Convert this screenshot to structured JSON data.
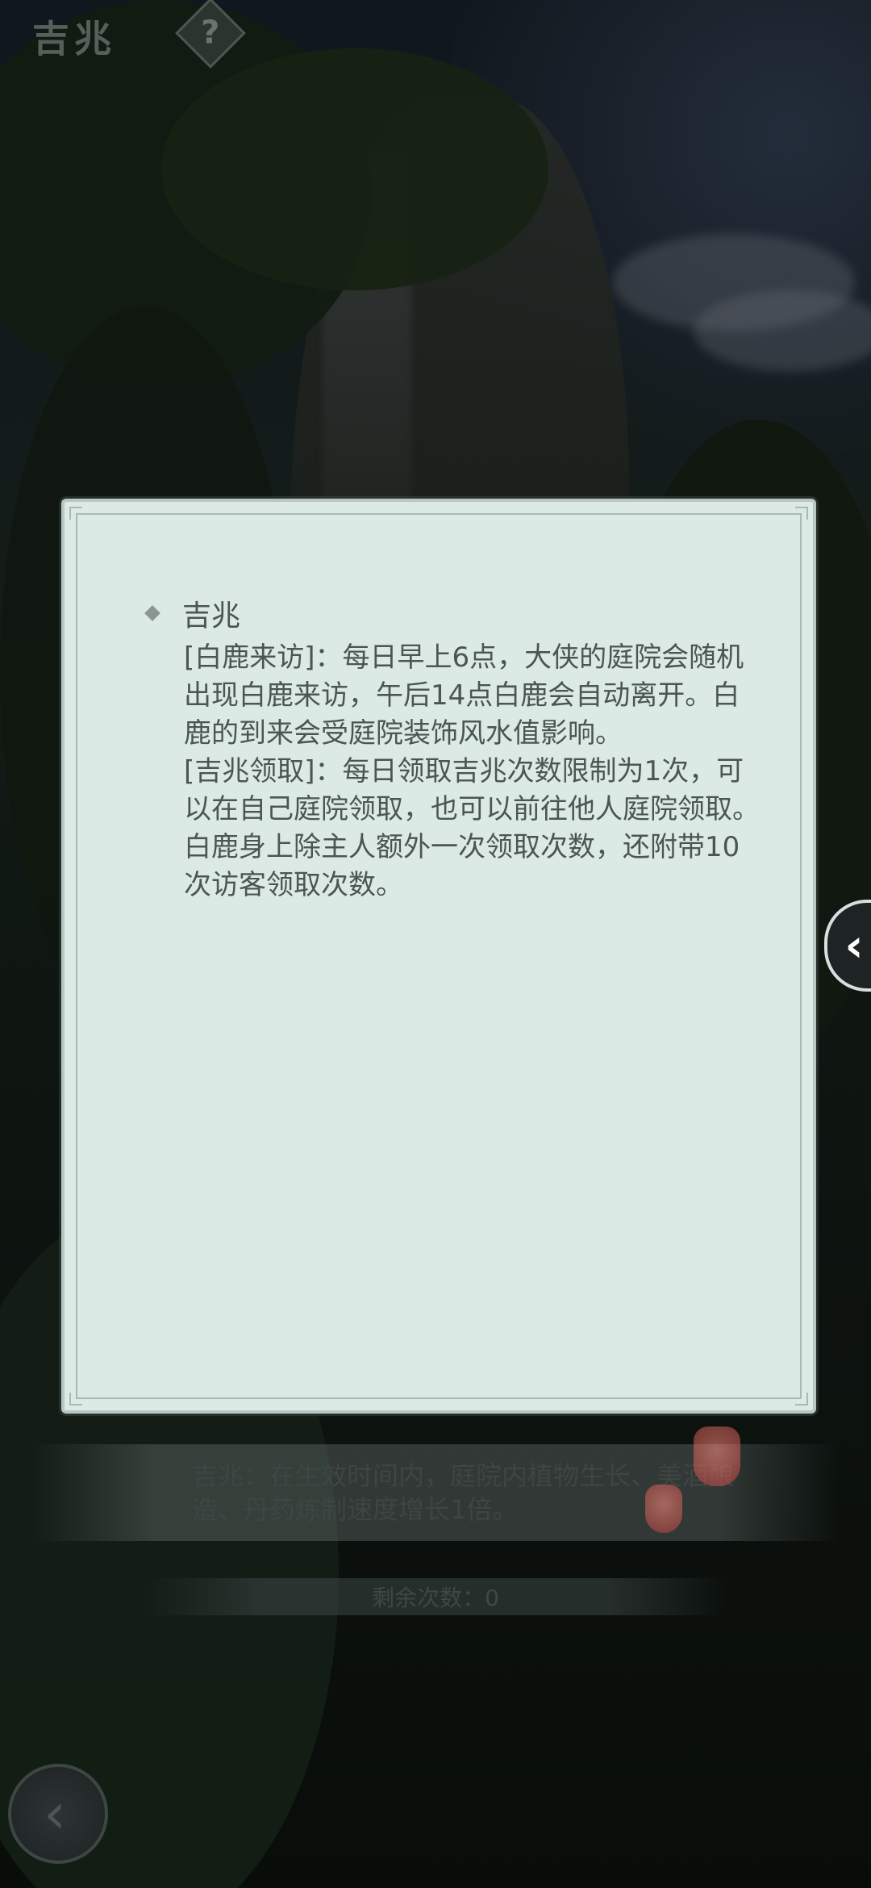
{
  "header": {
    "title": "吉兆",
    "help_icon": "?"
  },
  "dialog": {
    "heading": "吉兆",
    "paragraphs": [
      "[白鹿来访]：每日早上6点，大侠的庭院会随机出现白鹿来访，午后14点白鹿会自动离开。白鹿的到来会受庭院装饰风水值影响。",
      "[吉兆领取]：每日领取吉兆次数限制为1次，可以在自己庭院领取，也可以前往他人庭院领取。白鹿身上除主人额外一次领取次数，还附带10次访客领取次数。"
    ]
  },
  "side_tab": {
    "arrow": "‹"
  },
  "background_panel": {
    "description": "吉兆：在生效时间内，庭院内植物生长、美酒酿造、丹药炼制速度增长1倍。",
    "remaining_count": "剩余次数：0"
  },
  "back_button": {
    "icon": "‹"
  }
}
